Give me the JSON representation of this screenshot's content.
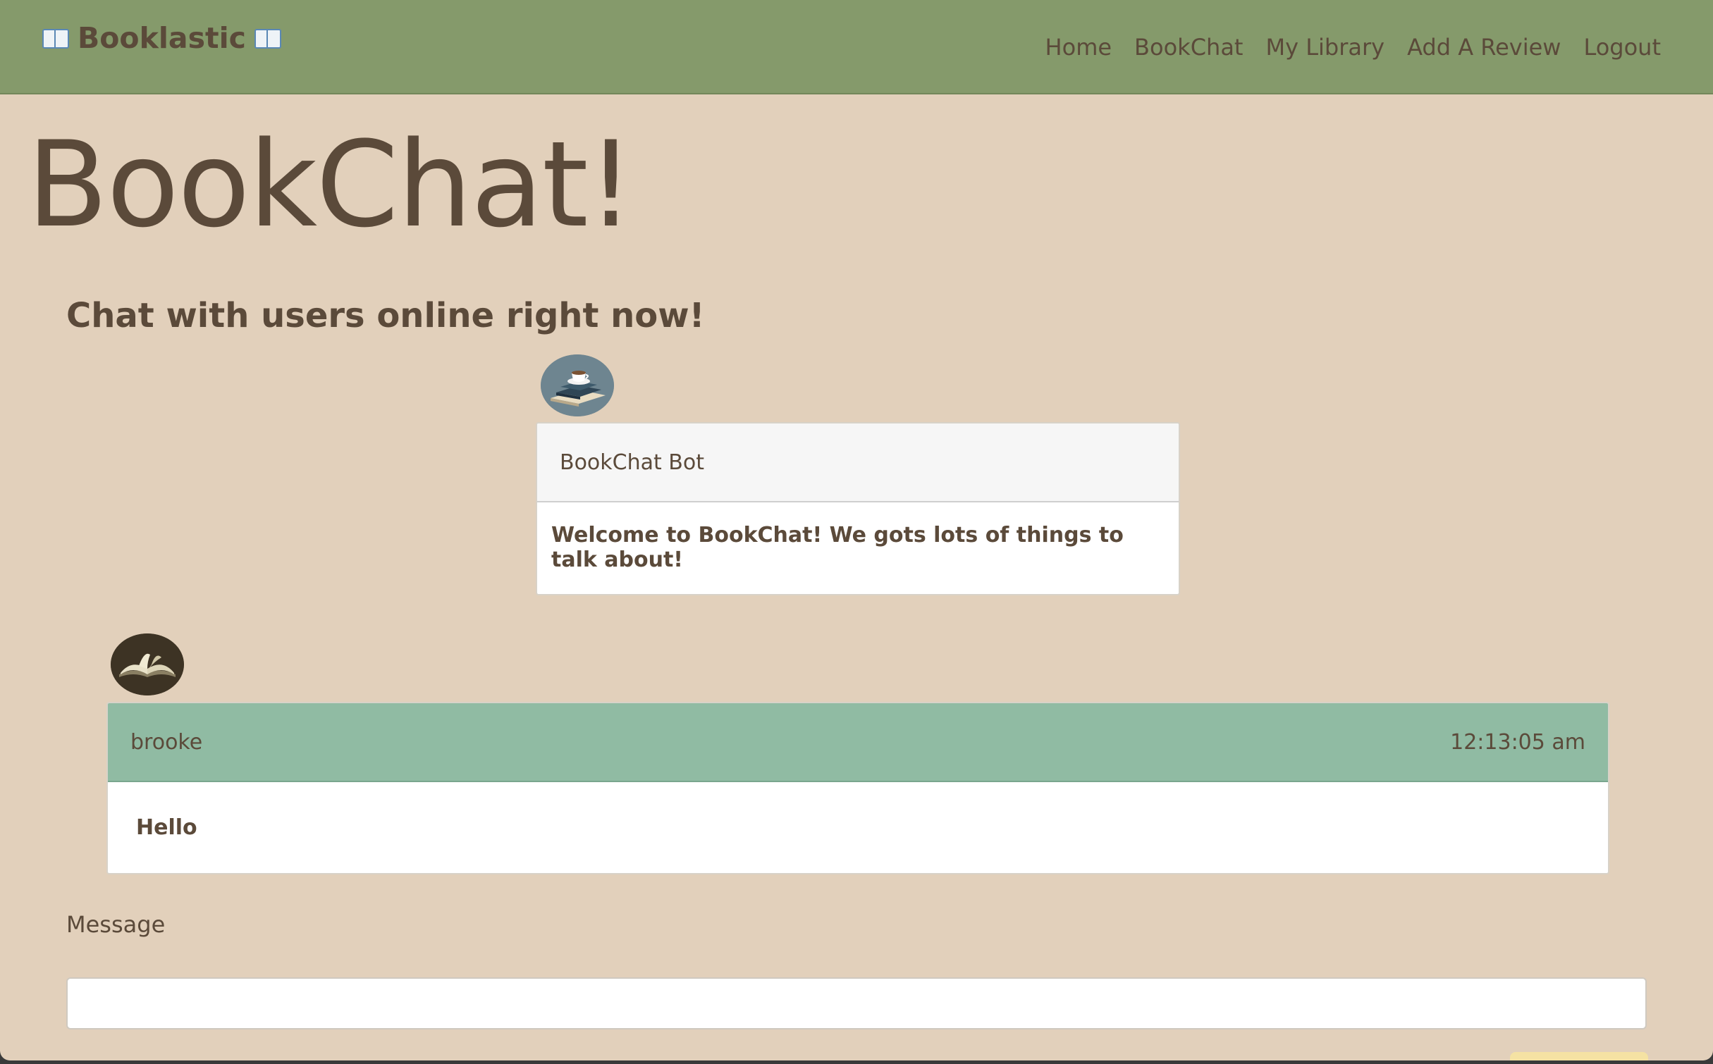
{
  "navbar": {
    "brand": "Booklastic",
    "links": [
      "Home",
      "BookChat",
      "My Library",
      "Add A Review",
      "Logout"
    ]
  },
  "page": {
    "title": "BookChat!",
    "subtitle": "Chat with users online right now!"
  },
  "messages": [
    {
      "author": "BookChat Bot",
      "time": "",
      "text": "Welcome to BookChat! We gots lots of things to talk about!",
      "avatar_icon": "coffee-books-icon"
    },
    {
      "author": "brooke",
      "time": "12:13:05 am",
      "text": "Hello",
      "avatar_icon": "open-book-icon"
    }
  ],
  "form": {
    "message_label": "Message",
    "message_value": "",
    "send_label": ""
  },
  "colors": {
    "navbar": "#859a6b",
    "background": "#e2d0bb",
    "text": "#5b4a3a",
    "user_header": "#90bba3",
    "bot_header": "#f6f6f6",
    "send_button": "#f5e2a3"
  }
}
